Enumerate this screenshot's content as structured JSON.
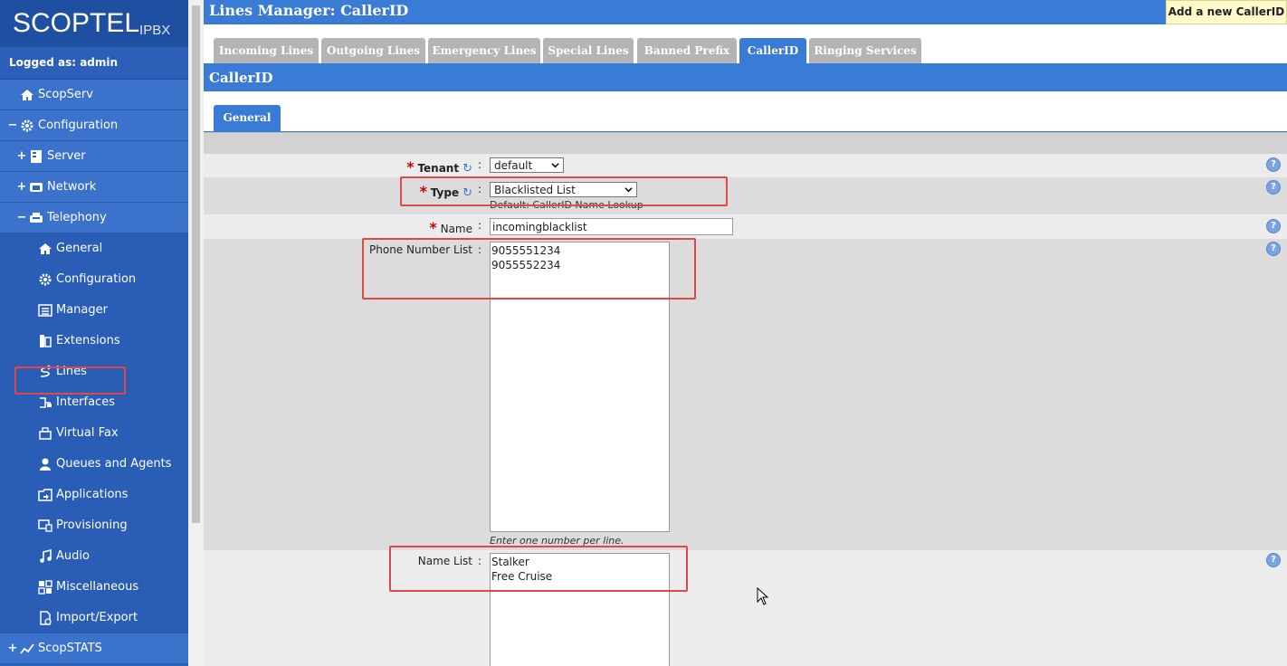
{
  "brand": {
    "logo_main": "SCOPTEL",
    "logo_suffix": "IPBX"
  },
  "sidebar": {
    "logged_as": "Logged as: admin",
    "items": [
      {
        "label": "ScopServ",
        "icon": "home-icon",
        "toggle": "",
        "sub": false
      },
      {
        "label": "Configuration",
        "icon": "gear-icon",
        "toggle": "−",
        "sub": false
      },
      {
        "label": "Server",
        "icon": "server-icon",
        "toggle": "+",
        "sub": false
      },
      {
        "label": "Network",
        "icon": "network-icon",
        "toggle": "+",
        "sub": false
      },
      {
        "label": "Telephony",
        "icon": "telephony-icon",
        "toggle": "−",
        "sub": false
      },
      {
        "label": "General",
        "icon": "home-icon",
        "toggle": "",
        "sub": true
      },
      {
        "label": "Configuration",
        "icon": "gear-icon",
        "toggle": "",
        "sub": true
      },
      {
        "label": "Manager",
        "icon": "manager-icon",
        "toggle": "",
        "sub": true
      },
      {
        "label": "Extensions",
        "icon": "phone-icon",
        "toggle": "",
        "sub": true
      },
      {
        "label": "Lines",
        "icon": "lines-icon",
        "toggle": "",
        "sub": true
      },
      {
        "label": "Interfaces",
        "icon": "interfaces-icon",
        "toggle": "",
        "sub": true
      },
      {
        "label": "Virtual Fax",
        "icon": "fax-icon",
        "toggle": "",
        "sub": true
      },
      {
        "label": "Queues and Agents",
        "icon": "agent-icon",
        "toggle": "",
        "sub": true
      },
      {
        "label": "Applications",
        "icon": "applications-icon",
        "toggle": "",
        "sub": true
      },
      {
        "label": "Provisioning",
        "icon": "provisioning-icon",
        "toggle": "",
        "sub": true
      },
      {
        "label": "Audio",
        "icon": "music-icon",
        "toggle": "",
        "sub": true
      },
      {
        "label": "Miscellaneous",
        "icon": "misc-icon",
        "toggle": "",
        "sub": true
      },
      {
        "label": "Import/Export",
        "icon": "import-export-icon",
        "toggle": "",
        "sub": true
      },
      {
        "label": "ScopSTATS",
        "icon": "stats-icon",
        "toggle": "+",
        "sub": false
      }
    ]
  },
  "header": {
    "title": "Lines Manager:  CallerID",
    "add_button": "Add a new CallerID"
  },
  "tabs": [
    "Incoming Lines",
    "Outgoing Lines",
    "Emergency Lines",
    "Special Lines",
    "Banned Prefix",
    "CallerID",
    "Ringing Services"
  ],
  "active_tab": "CallerID",
  "section_title": "CallerID",
  "subtab": "General",
  "form": {
    "tenant_label": "Tenant",
    "tenant_value": "default",
    "type_label": "Type",
    "type_value": "Blacklisted List",
    "type_hint": "Default: CallerID Name Lookup",
    "name_label": "Name",
    "name_value": "incomingblacklist",
    "phone_label": "Phone Number List",
    "phone_value": "9055551234\n9055552234",
    "phone_hint": "Enter one number per line.",
    "namelist_label": "Name List",
    "namelist_value": "Stalker\nFree Cruise"
  },
  "colors": {
    "accent": "#3a7bd5",
    "sidebar": "#2f66c0",
    "highlight": "#e04848"
  }
}
